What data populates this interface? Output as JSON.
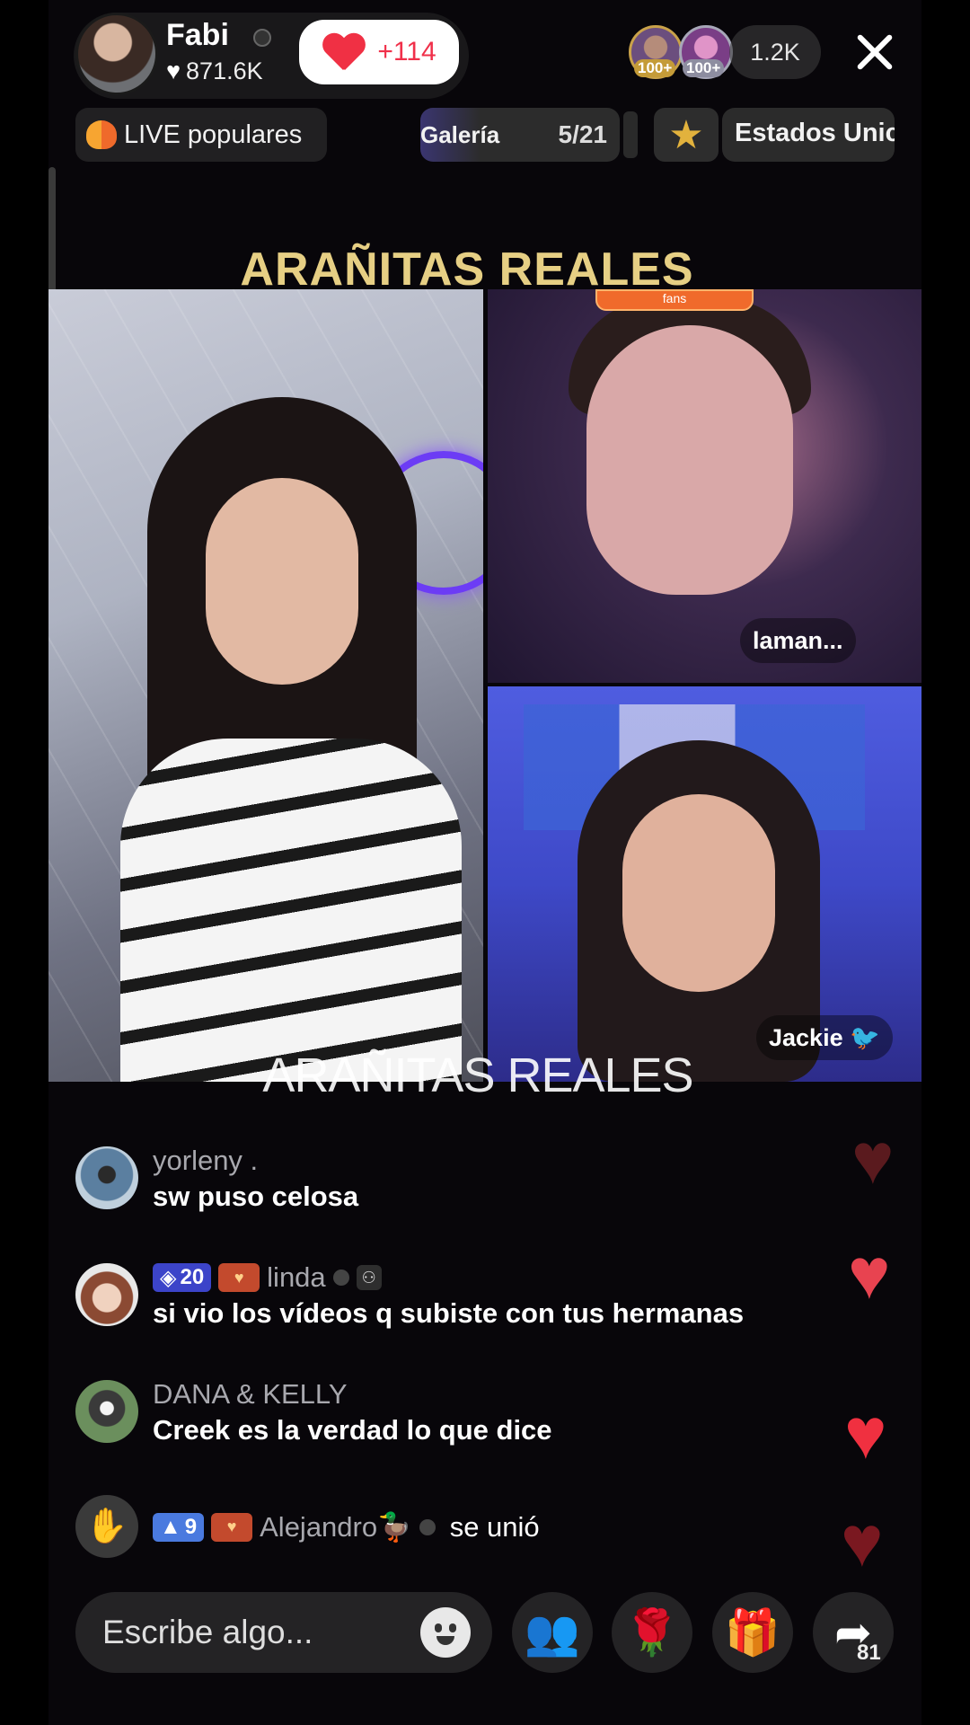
{
  "header": {
    "host_name": "Fabi",
    "host_likes": "871.6K",
    "follow_label": "+114",
    "viewer_badges": [
      "100+",
      "100+"
    ],
    "viewer_count": "1.2K",
    "close_icon": "close-icon"
  },
  "tabs": {
    "live_popular": "LIVE populares",
    "gallery_label": "Galería",
    "gallery_count": "5/21",
    "region_label": "Estados Unic"
  },
  "stream": {
    "title_top": "ARAÑITAS REALES",
    "watermark": "ARAÑITAS REALES",
    "fans_banner": "fans",
    "guest_top_name": "laman...",
    "guest_bottom_name": "Jackie 🐦"
  },
  "comments": [
    {
      "user": "yorleny .",
      "text": "sw puso celosa",
      "avatar_color": "#5b7fa0"
    },
    {
      "user": "linda",
      "level": "20",
      "text": "si vio los vídeos q subiste con tus hermanas",
      "avatar_color": "#c99a7c"
    },
    {
      "user": "DANA & KELLY",
      "text": "Creek es la verdad lo que dice",
      "avatar_color": "#6b8f5d"
    },
    {
      "user": "Alejandro🦆",
      "level": "9",
      "text": "se unió",
      "avatar_icon": "wave-hand-icon"
    }
  ],
  "bottom_bar": {
    "input_placeholder": "Escribe algo...",
    "share_count": "81",
    "icons": [
      "emoji-icon",
      "guests-icon",
      "rose-gift-icon",
      "gift-icon",
      "share-icon"
    ]
  },
  "colors": {
    "accent_red": "#f0304a",
    "title_gold": "#e6cf84",
    "level_badge": "#3c44c9"
  }
}
